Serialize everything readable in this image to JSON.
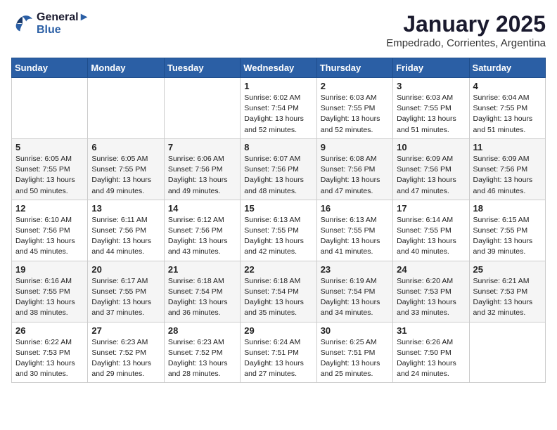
{
  "logo": {
    "line1": "General",
    "line2": "Blue"
  },
  "title": "January 2025",
  "location": "Empedrado, Corrientes, Argentina",
  "weekdays": [
    "Sunday",
    "Monday",
    "Tuesday",
    "Wednesday",
    "Thursday",
    "Friday",
    "Saturday"
  ],
  "weeks": [
    [
      {
        "day": "",
        "info": ""
      },
      {
        "day": "",
        "info": ""
      },
      {
        "day": "",
        "info": ""
      },
      {
        "day": "1",
        "info": "Sunrise: 6:02 AM\nSunset: 7:54 PM\nDaylight: 13 hours and 52 minutes."
      },
      {
        "day": "2",
        "info": "Sunrise: 6:03 AM\nSunset: 7:55 PM\nDaylight: 13 hours and 52 minutes."
      },
      {
        "day": "3",
        "info": "Sunrise: 6:03 AM\nSunset: 7:55 PM\nDaylight: 13 hours and 51 minutes."
      },
      {
        "day": "4",
        "info": "Sunrise: 6:04 AM\nSunset: 7:55 PM\nDaylight: 13 hours and 51 minutes."
      }
    ],
    [
      {
        "day": "5",
        "info": "Sunrise: 6:05 AM\nSunset: 7:55 PM\nDaylight: 13 hours and 50 minutes."
      },
      {
        "day": "6",
        "info": "Sunrise: 6:05 AM\nSunset: 7:55 PM\nDaylight: 13 hours and 49 minutes."
      },
      {
        "day": "7",
        "info": "Sunrise: 6:06 AM\nSunset: 7:56 PM\nDaylight: 13 hours and 49 minutes."
      },
      {
        "day": "8",
        "info": "Sunrise: 6:07 AM\nSunset: 7:56 PM\nDaylight: 13 hours and 48 minutes."
      },
      {
        "day": "9",
        "info": "Sunrise: 6:08 AM\nSunset: 7:56 PM\nDaylight: 13 hours and 47 minutes."
      },
      {
        "day": "10",
        "info": "Sunrise: 6:09 AM\nSunset: 7:56 PM\nDaylight: 13 hours and 47 minutes."
      },
      {
        "day": "11",
        "info": "Sunrise: 6:09 AM\nSunset: 7:56 PM\nDaylight: 13 hours and 46 minutes."
      }
    ],
    [
      {
        "day": "12",
        "info": "Sunrise: 6:10 AM\nSunset: 7:56 PM\nDaylight: 13 hours and 45 minutes."
      },
      {
        "day": "13",
        "info": "Sunrise: 6:11 AM\nSunset: 7:56 PM\nDaylight: 13 hours and 44 minutes."
      },
      {
        "day": "14",
        "info": "Sunrise: 6:12 AM\nSunset: 7:56 PM\nDaylight: 13 hours and 43 minutes."
      },
      {
        "day": "15",
        "info": "Sunrise: 6:13 AM\nSunset: 7:55 PM\nDaylight: 13 hours and 42 minutes."
      },
      {
        "day": "16",
        "info": "Sunrise: 6:13 AM\nSunset: 7:55 PM\nDaylight: 13 hours and 41 minutes."
      },
      {
        "day": "17",
        "info": "Sunrise: 6:14 AM\nSunset: 7:55 PM\nDaylight: 13 hours and 40 minutes."
      },
      {
        "day": "18",
        "info": "Sunrise: 6:15 AM\nSunset: 7:55 PM\nDaylight: 13 hours and 39 minutes."
      }
    ],
    [
      {
        "day": "19",
        "info": "Sunrise: 6:16 AM\nSunset: 7:55 PM\nDaylight: 13 hours and 38 minutes."
      },
      {
        "day": "20",
        "info": "Sunrise: 6:17 AM\nSunset: 7:55 PM\nDaylight: 13 hours and 37 minutes."
      },
      {
        "day": "21",
        "info": "Sunrise: 6:18 AM\nSunset: 7:54 PM\nDaylight: 13 hours and 36 minutes."
      },
      {
        "day": "22",
        "info": "Sunrise: 6:18 AM\nSunset: 7:54 PM\nDaylight: 13 hours and 35 minutes."
      },
      {
        "day": "23",
        "info": "Sunrise: 6:19 AM\nSunset: 7:54 PM\nDaylight: 13 hours and 34 minutes."
      },
      {
        "day": "24",
        "info": "Sunrise: 6:20 AM\nSunset: 7:53 PM\nDaylight: 13 hours and 33 minutes."
      },
      {
        "day": "25",
        "info": "Sunrise: 6:21 AM\nSunset: 7:53 PM\nDaylight: 13 hours and 32 minutes."
      }
    ],
    [
      {
        "day": "26",
        "info": "Sunrise: 6:22 AM\nSunset: 7:53 PM\nDaylight: 13 hours and 30 minutes."
      },
      {
        "day": "27",
        "info": "Sunrise: 6:23 AM\nSunset: 7:52 PM\nDaylight: 13 hours and 29 minutes."
      },
      {
        "day": "28",
        "info": "Sunrise: 6:23 AM\nSunset: 7:52 PM\nDaylight: 13 hours and 28 minutes."
      },
      {
        "day": "29",
        "info": "Sunrise: 6:24 AM\nSunset: 7:51 PM\nDaylight: 13 hours and 27 minutes."
      },
      {
        "day": "30",
        "info": "Sunrise: 6:25 AM\nSunset: 7:51 PM\nDaylight: 13 hours and 25 minutes."
      },
      {
        "day": "31",
        "info": "Sunrise: 6:26 AM\nSunset: 7:50 PM\nDaylight: 13 hours and 24 minutes."
      },
      {
        "day": "",
        "info": ""
      }
    ]
  ]
}
